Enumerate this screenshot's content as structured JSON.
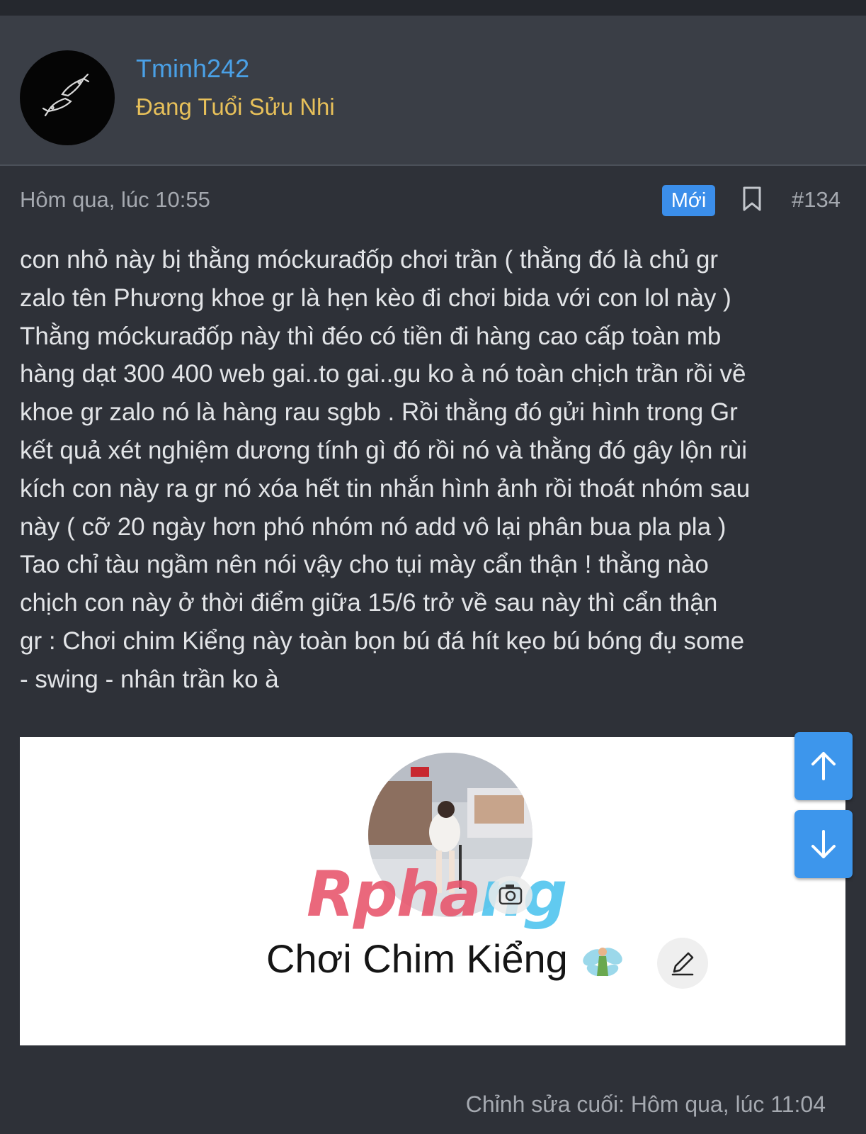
{
  "user": {
    "name": "Tminh242",
    "title": "Đang Tuổi Sửu Nhi",
    "avatar_icon": "koi-fish-logo-icon"
  },
  "post": {
    "timestamp": "Hôm qua, lúc 10:55",
    "badge": "Mới",
    "number": "#134",
    "body": "con nhỏ này bị thằng móckurađốp chơi trần ( thằng đó là chủ gr\nzalo tên Phương khoe gr là hẹn kèo đi chơi bida với con lol này )\nThằng móckurađốp này thì đéo có tiền đi hàng cao cấp toàn mb\nhàng dạt 300 400 web gai..to gai..gu ko à nó toàn chịch trần rồi về\nkhoe gr zalo nó là hàng rau sgbb . Rồi thằng đó gửi hình trong Gr\nkết quả xét nghiệm dương tính gì đó rồi nó và thằng đó gây lộn rùi\nkích con này ra gr nó xóa hết tin nhắn hình ảnh rồi thoát nhóm sau\nnày ( cỡ 20 ngày hơn phó nhóm nó add vô lại phân bua pla pla )\nTao chỉ tàu ngầm nên nói vậy cho tụi mày cẩn thận ! thằng nào\nchịch con này ở thời điểm giữa 15/6 trở về sau này thì cẩn thận\ngr : Chơi chim Kiểng này toàn bọn bú đá hít kẹo bú bóng đụ some\n- swing - nhân trần ko à",
    "last_edited": "Chỉnh sửa cuối: Hôm qua, lúc 11:04"
  },
  "attachment": {
    "profile_name": "Chơi Chim Kiểng",
    "watermark_main": "Rpha",
    "watermark_tail": "ng",
    "icons": [
      "camera-icon",
      "fairy-icon",
      "pencil-icon"
    ]
  },
  "scroll": {
    "up_icon": "arrow-up-icon",
    "down_icon": "arrow-down-icon"
  },
  "colors": {
    "background": "#2e3138",
    "header_bg": "#3a3e46",
    "username": "#4aa0e6",
    "user_title": "#e7c05a",
    "accent": "#3b8eea"
  }
}
